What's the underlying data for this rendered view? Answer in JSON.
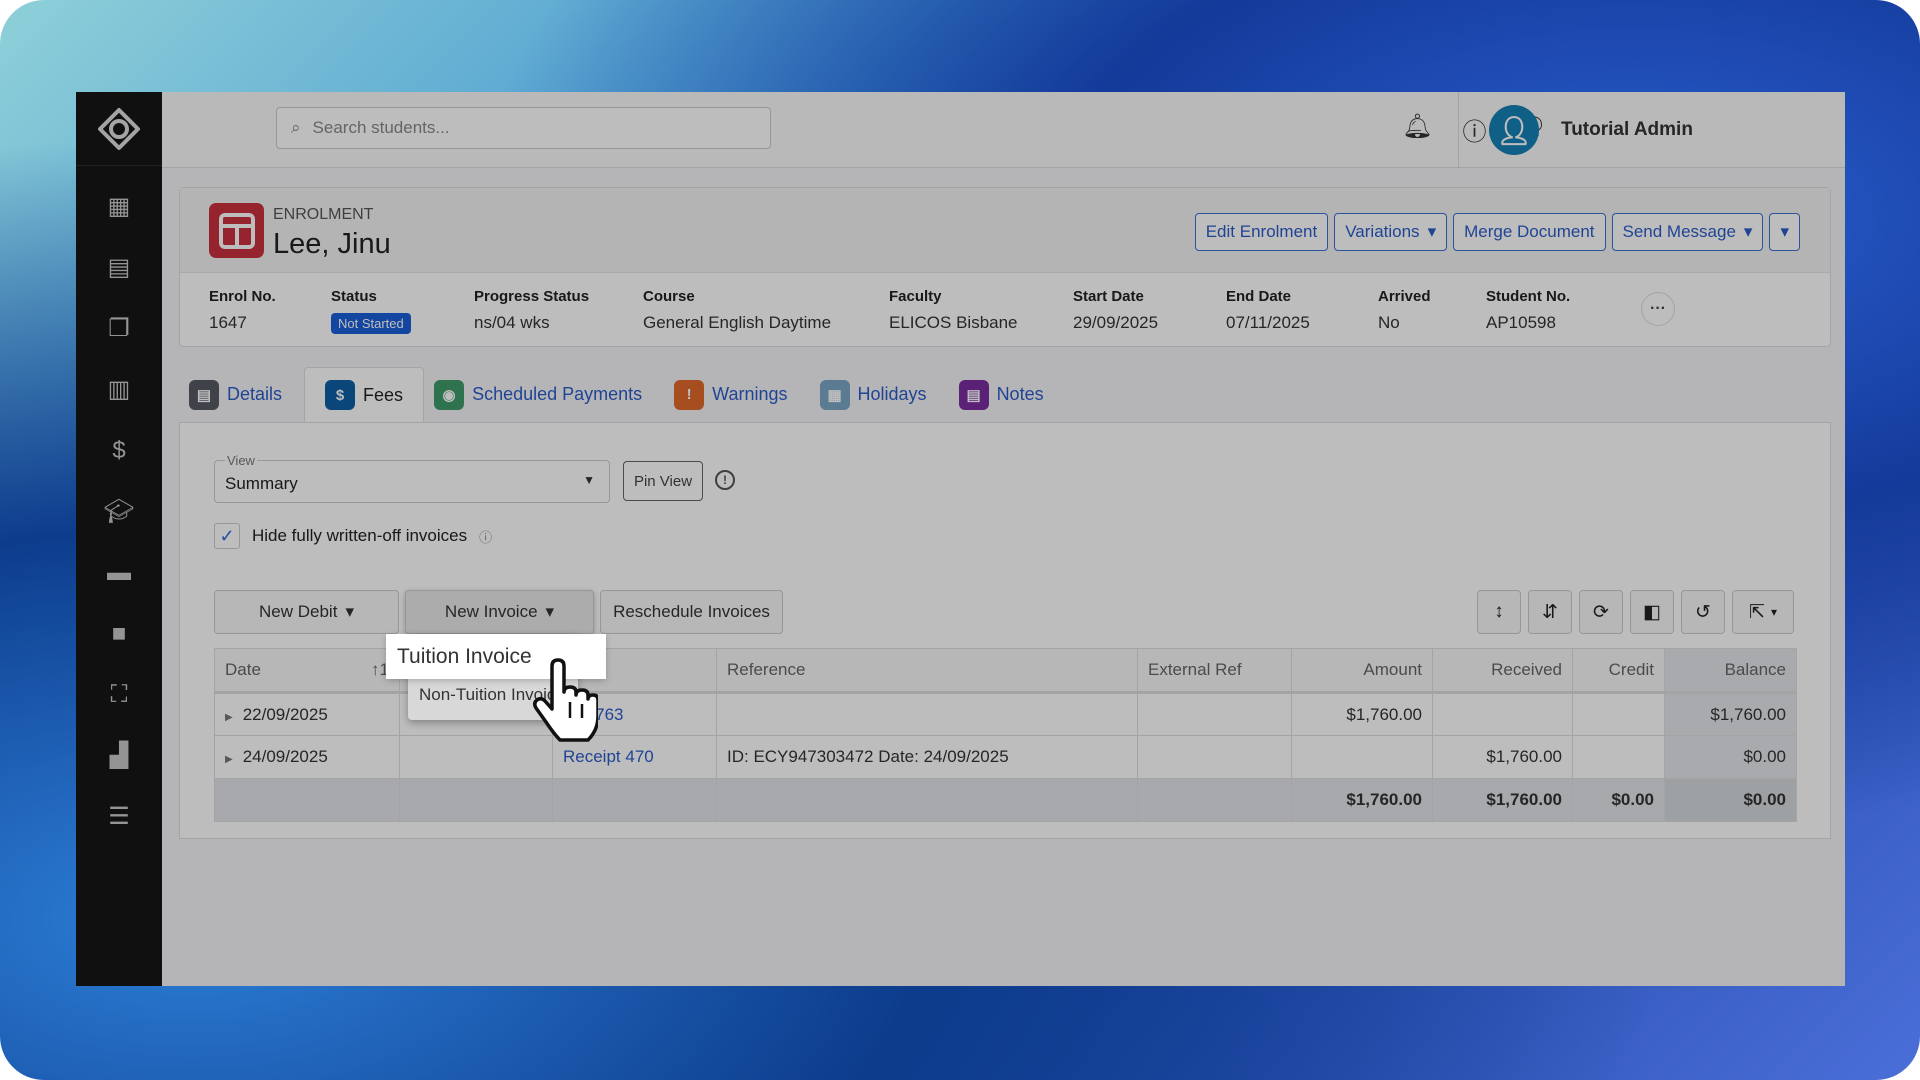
{
  "topbar": {
    "search_placeholder": "Search students...",
    "user_name": "Tutorial Admin"
  },
  "sidebar": {
    "items": [
      "dashboard-icon",
      "students-icon",
      "enrolments-icon",
      "layout-icon",
      "fees-icon",
      "courses-icon",
      "book-icon",
      "briefcase-icon",
      "network-icon",
      "buildings-icon",
      "settings-sliders-icon"
    ]
  },
  "enrolment": {
    "label": "ENROLMENT",
    "name": "Lee, Jinu",
    "actions": {
      "edit": "Edit Enrolment",
      "variations": "Variations",
      "merge": "Merge Document",
      "send": "Send Message"
    },
    "fields": [
      {
        "key": "Enrol No.",
        "value": "1647"
      },
      {
        "key": "Status",
        "value": "Not Started"
      },
      {
        "key": "Progress Status",
        "value": "ns/04 wks"
      },
      {
        "key": "Course",
        "value": "General English Daytime"
      },
      {
        "key": "Faculty",
        "value": "ELICOS Bisbane"
      },
      {
        "key": "Start Date",
        "value": "29/09/2025"
      },
      {
        "key": "End Date",
        "value": "07/11/2025"
      },
      {
        "key": "Arrived",
        "value": "No"
      },
      {
        "key": "Student No.",
        "value": "AP10598"
      }
    ],
    "status_color": "#1a5fd8"
  },
  "tabs": [
    {
      "label": "Details",
      "color": "#555b63"
    },
    {
      "label": "Fees",
      "color": "#0e5fa3",
      "active": true
    },
    {
      "label": "Scheduled Payments",
      "color": "#3f9a6a"
    },
    {
      "label": "Warnings",
      "color": "#e0692a"
    },
    {
      "label": "Holidays",
      "color": "#7aa6c4"
    },
    {
      "label": "Notes",
      "color": "#7a2da0"
    }
  ],
  "fees": {
    "view_label": "View",
    "view_value": "Summary",
    "pin_view": "Pin View",
    "hide_written_off": {
      "label": "Hide fully written-off invoices",
      "checked": true
    },
    "buttons": {
      "new_debit": "New Debit",
      "new_invoice": "New Invoice",
      "reschedule": "Reschedule Invoices"
    },
    "menu": {
      "tuition": "Tuition Invoice",
      "non_tuition": "Non-Tuition Invoice"
    },
    "table": {
      "columns": [
        "Date",
        "",
        "y",
        "Reference",
        "External Ref",
        "Amount",
        "Received",
        "Credit",
        "Balance"
      ],
      "sort_indicator": "↑1",
      "rows": [
        [
          "22/09/2025",
          "",
          "ce 2763",
          "",
          "",
          "$1,760.00",
          "",
          "",
          "$1,760.00"
        ],
        [
          "24/09/2025",
          "",
          "Receipt 470",
          "ID: ECY947303472 Date: 24/09/2025",
          "",
          "",
          "$1,760.00",
          "",
          "$0.00"
        ]
      ],
      "totals": [
        "",
        "",
        "",
        "",
        "",
        "$1,760.00",
        "$1,760.00",
        "$0.00",
        "$0.00"
      ]
    }
  }
}
